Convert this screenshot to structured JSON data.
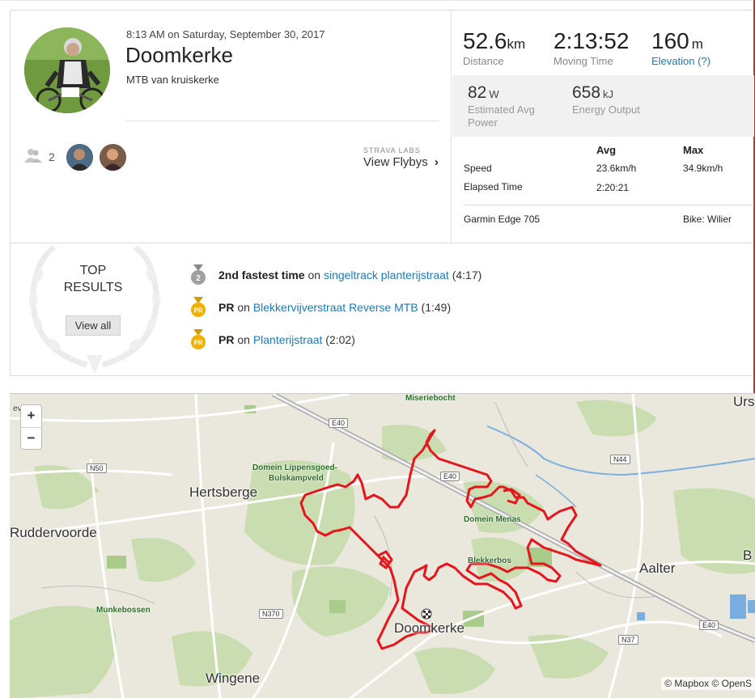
{
  "activity": {
    "datetime": "8:13 AM on Saturday, September 30, 2017",
    "name": "Doomkerke",
    "description": "MTB van kruiskerke",
    "kudos_count": "2",
    "labs_label": "STRAVA LABS",
    "flybys_label": "View Flybys",
    "flybys_chevron": "›"
  },
  "stats": {
    "distance": {
      "value": "52.6",
      "unit": "km",
      "label": "Distance"
    },
    "moving_time": {
      "value": "2:13:52",
      "label": "Moving Time"
    },
    "elevation": {
      "value": "160",
      "unit": "m",
      "label": "Elevation (?)"
    },
    "power": {
      "value": "82",
      "unit": "W",
      "label_1": "Estimated Avg",
      "label_2": "Power"
    },
    "energy": {
      "value": "658",
      "unit": "kJ",
      "label": "Energy Output"
    },
    "table": {
      "col_avg": "Avg",
      "col_max": "Max",
      "speed_label": "Speed",
      "speed_avg": "23.6km/h",
      "speed_max": "34.9km/h",
      "elapsed_label": "Elapsed Time",
      "elapsed_avg": "2:20:21"
    },
    "device": "Garmin Edge 705",
    "bike": "Bike: Wilier"
  },
  "top_results": {
    "label_1": "TOP",
    "label_2": "RESULTS",
    "view_all": "View all",
    "items": [
      {
        "medal": "2",
        "bold": "2nd fastest time",
        "on": "on",
        "segment": "singeltrack planterijstraat",
        "time": "(4:17)"
      },
      {
        "medal": "PR",
        "bold": "PR",
        "on": "on",
        "segment": "Blekkervijverstraat Reverse MTB",
        "time": "(1:49)"
      },
      {
        "medal": "PR",
        "bold": "PR",
        "on": "on",
        "segment": "Planterijstraat",
        "time": "(2:02)"
      }
    ]
  },
  "map": {
    "zoom_in": "+",
    "zoom_out": "−",
    "attribution": "© Mapbox © OpenS",
    "places": {
      "urs": "Urs",
      "everen": "everen",
      "miseriebocht": "Miseriebocht",
      "hertsberge": "Hertsberge",
      "ruddervoorde": "Ruddervoorde",
      "domein_lippensgoed_1": "Domein Lippensgoed-",
      "domein_lippensgoed_2": "Bulskampveld",
      "domein_menas": "Domein Menas",
      "blekkerbos": "Blekkerbos",
      "aalter": "Aalter",
      "b": "B",
      "munkebossen": "Munkebossen",
      "doomkerke": "Doomkerke",
      "wingene": "Wingene"
    },
    "roads": {
      "e40_a": "E40",
      "e40_b": "E40",
      "e40_c": "E40",
      "n50": "N50",
      "n44": "N44",
      "n370": "N370",
      "n37": "N37"
    }
  },
  "colors": {
    "link": "#1f79b9",
    "route": "#e8141c",
    "frame": "#d9262f",
    "map_bg": "#eae7dc",
    "forest": "#c9ddb0"
  }
}
